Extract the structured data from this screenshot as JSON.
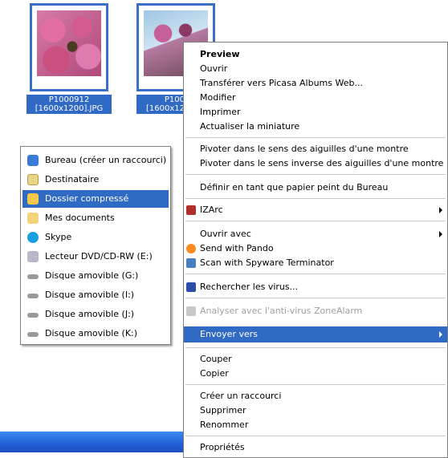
{
  "thumbnails": [
    {
      "name_line1": "P1000912",
      "name_line2": "[1600x1200].JPG"
    },
    {
      "name_line1": "P100",
      "name_line2": "[1600x12"
    }
  ],
  "context_menu": {
    "preview": "Preview",
    "ouvrir": "Ouvrir",
    "picasa": "Transférer vers Picasa Albums Web...",
    "modifier": "Modifier",
    "imprimer": "Imprimer",
    "actualiser": "Actualiser la miniature",
    "pivoter_horaire": "Pivoter dans le sens des aiguilles d'une montre",
    "pivoter_antihoraire": "Pivoter dans le sens inverse des aiguilles d'une montre",
    "papier_peint": "Définir en tant que papier peint du Bureau",
    "izarc": "IZArc",
    "ouvrir_avec": "Ouvrir avec",
    "pando": "Send with Pando",
    "spyware": "Scan with Spyware Terminator",
    "virus": "Rechercher les virus...",
    "zonealarm": "Analyser avec l'anti-virus ZoneAlarm",
    "envoyer_vers": "Envoyer vers",
    "couper": "Couper",
    "copier": "Copier",
    "raccourci": "Créer un raccourci",
    "supprimer": "Supprimer",
    "renommer": "Renommer",
    "proprietes": "Propriétés"
  },
  "send_to_menu": {
    "bureau": "Bureau (créer un raccourci)",
    "destinataire": "Destinataire",
    "dossier": "Dossier compressé",
    "documents": "Mes documents",
    "skype": "Skype",
    "dvd": "Lecteur DVD/CD-RW (E:)",
    "disque_g": "Disque amovible (G:)",
    "disque_i": "Disque amovible (I:)",
    "disque_j": "Disque amovible (J:)",
    "disque_k": "Disque amovible (K:)"
  },
  "colors": {
    "selection": "#316ac5",
    "taskbar": "#2563d8"
  }
}
